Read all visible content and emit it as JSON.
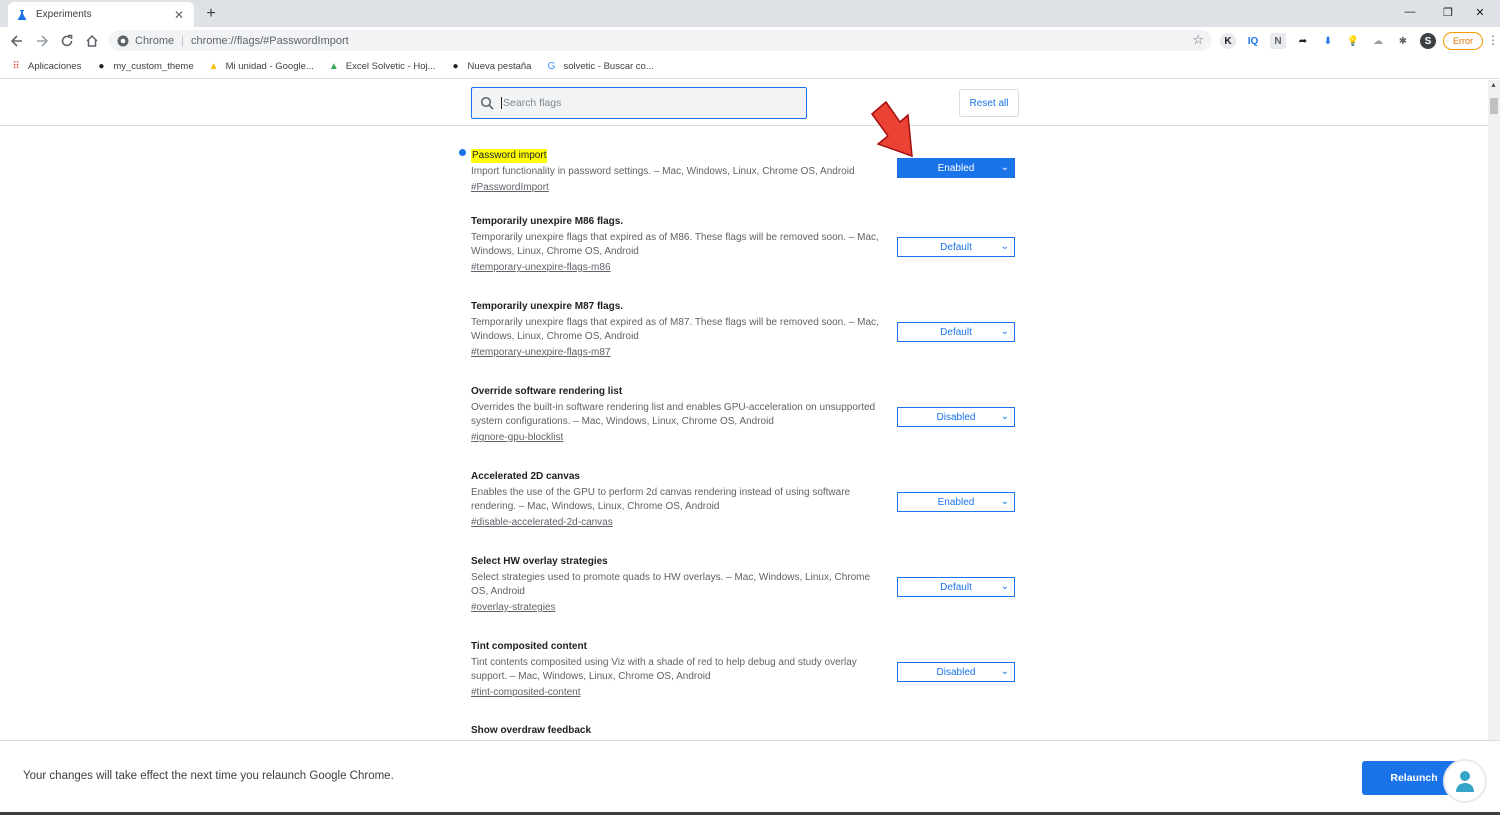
{
  "browser": {
    "tab_title": "Experiments",
    "tab_close": "✕",
    "new_tab": "+",
    "window_controls": [
      "—",
      "❐",
      "✕"
    ],
    "omnibox": {
      "chip": "Chrome",
      "separator": "|",
      "url": "chrome://flags/#PasswordImport"
    },
    "extensions": [
      {
        "icon": "k-extension-icon",
        "glyph": "K",
        "color": "#202124"
      },
      {
        "icon": "iq-extension-icon",
        "glyph": "IQ",
        "color": "#1a73e8"
      },
      {
        "icon": "n-extension-icon",
        "glyph": "N",
        "color": "#5f6368"
      },
      {
        "icon": "arrow-extension-icon",
        "glyph": "➦",
        "color": "#202124"
      },
      {
        "icon": "download-extension-icon",
        "glyph": "⬇",
        "color": "#1a73e8"
      },
      {
        "icon": "bulb-extension-icon",
        "glyph": "💡",
        "color": "#5f6368"
      },
      {
        "icon": "cloud-extension-icon",
        "glyph": "☁",
        "color": "#9aa0a6"
      },
      {
        "icon": "puzzle-extension-icon",
        "glyph": "✱",
        "color": "#5f6368"
      },
      {
        "icon": "profile-avatar-icon",
        "glyph": "S",
        "color": "#ffffff"
      }
    ],
    "error_button": "Error",
    "menu_glyph": "⋮"
  },
  "bookmarks": [
    {
      "label": "Aplicaciones",
      "icon": "apps-grid-icon",
      "glyph": "⠿",
      "color": "#ea4335"
    },
    {
      "label": "my_custom_theme",
      "icon": "github-icon",
      "glyph": "●",
      "color": "#202124"
    },
    {
      "label": "Mi unidad - Google...",
      "icon": "google-drive-icon",
      "glyph": "▲",
      "color": "#fbbc04"
    },
    {
      "label": "Excel Solvetic - Hoj...",
      "icon": "google-drive-icon",
      "glyph": "▲",
      "color": "#34a853"
    },
    {
      "label": "Nueva pestaña",
      "icon": "github-icon",
      "glyph": "●",
      "color": "#202124"
    },
    {
      "label": "solvetic - Buscar co...",
      "icon": "google-g-icon",
      "glyph": "G",
      "color": "#4285f4"
    }
  ],
  "search": {
    "placeholder": "Search flags"
  },
  "reset_label": "Reset all",
  "flags": [
    {
      "name": "Password import",
      "desc": "Import functionality in password settings. – Mac, Windows, Linux, Chrome OS, Android",
      "link": "#PasswordImport",
      "value": "Enabled",
      "highlighted": true
    },
    {
      "name": "Temporarily unexpire M86 flags.",
      "desc": "Temporarily unexpire flags that expired as of M86. These flags will be removed soon. – Mac, Windows, Linux, Chrome OS, Android",
      "link": "#temporary-unexpire-flags-m86",
      "value": "Default"
    },
    {
      "name": "Temporarily unexpire M87 flags.",
      "desc": "Temporarily unexpire flags that expired as of M87. These flags will be removed soon. – Mac, Windows, Linux, Chrome OS, Android",
      "link": "#temporary-unexpire-flags-m87",
      "value": "Default"
    },
    {
      "name": "Override software rendering list",
      "desc": "Overrides the built-in software rendering list and enables GPU-acceleration on unsupported system configurations. – Mac, Windows, Linux, Chrome OS, Android",
      "link": "#ignore-gpu-blocklist",
      "value": "Disabled"
    },
    {
      "name": "Accelerated 2D canvas",
      "desc": "Enables the use of the GPU to perform 2d canvas rendering instead of using software rendering. – Mac, Windows, Linux, Chrome OS, Android",
      "link": "#disable-accelerated-2d-canvas",
      "value": "Enabled"
    },
    {
      "name": "Select HW overlay strategies",
      "desc": "Select strategies used to promote quads to HW overlays. – Mac, Windows, Linux, Chrome OS, Android",
      "link": "#overlay-strategies",
      "value": "Default"
    },
    {
      "name": "Tint composited content",
      "desc": "Tint contents composited using Viz with a shade of red to help debug and study overlay support. – Mac, Windows, Linux, Chrome OS, Android",
      "link": "#tint-composited-content",
      "value": "Disabled"
    },
    {
      "name": "Show overdraw feedback",
      "desc": "",
      "link": "",
      "value": ""
    }
  ],
  "footer": {
    "message": "Your changes will take effect the next time you relaunch Google Chrome.",
    "relaunch_label": "Relaunch"
  },
  "colors": {
    "accent": "#1a73e8",
    "highlight": "#ffff00",
    "annotation_arrow": "#ea4335"
  }
}
